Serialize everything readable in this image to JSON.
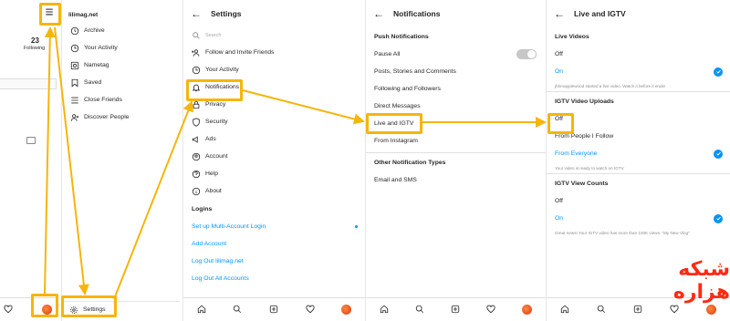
{
  "profile_panel": {
    "count": "23",
    "count_label": "Following"
  },
  "menu_panel": {
    "username": "lilimag.net",
    "items": [
      {
        "label": "Archive",
        "icon": "archive-icon"
      },
      {
        "label": "Your Activity",
        "icon": "activity-icon"
      },
      {
        "label": "Nametag",
        "icon": "nametag-icon"
      },
      {
        "label": "Saved",
        "icon": "bookmark-icon"
      },
      {
        "label": "Close Friends",
        "icon": "list-icon"
      },
      {
        "label": "Discover People",
        "icon": "add-person-icon"
      }
    ],
    "settings_label": "Settings"
  },
  "settings_panel": {
    "title": "Settings",
    "search_placeholder": "Search",
    "items": [
      {
        "label": "Follow and Invite Friends",
        "icon": "add-person-icon"
      },
      {
        "label": "Your Activity",
        "icon": "activity-icon"
      },
      {
        "label": "Notifications",
        "icon": "bell-icon"
      },
      {
        "label": "Privacy",
        "icon": "lock-icon"
      },
      {
        "label": "Security",
        "icon": "shield-icon"
      },
      {
        "label": "Ads",
        "icon": "megaphone-icon"
      },
      {
        "label": "Account",
        "icon": "account-icon"
      },
      {
        "label": "Help",
        "icon": "help-icon"
      },
      {
        "label": "About",
        "icon": "info-icon"
      }
    ],
    "logins_header": "Logins",
    "login_links": [
      "Set up Multi-Account Login",
      "Add Account",
      "Log Out lilimag.net",
      "Log Out All Accounts"
    ]
  },
  "notifications_panel": {
    "title": "Notifications",
    "push_header": "Push Notifications",
    "items": [
      "Pause All",
      "Posts, Stories and Comments",
      "Following and Followers",
      "Direct Messages",
      "Live and IGTV",
      "From Instagram"
    ],
    "other_header": "Other Notification Types",
    "other_items": [
      "Email and SMS"
    ]
  },
  "live_panel": {
    "title": "Live and IGTV",
    "live_header": "Live Videos",
    "live_off": "Off",
    "live_on": "On",
    "live_note": "jhhmapplewood started a live video. Watch it before it ends!",
    "igtv_header": "IGTV Video Uploads",
    "igtv_off": "Off",
    "igtv_people": "From People I Follow",
    "igtv_everyone": "From Everyone",
    "igtv_note": "Your video is ready to watch on IGTV.",
    "count_header": "IGTV View Counts",
    "count_off": "Off",
    "count_on": "On",
    "count_note": "Great news! Your IGTV video has more than 100K views. \"My New Vlog\""
  },
  "watermark": "شبکه هزاره",
  "colors": {
    "highlight": "#f5b50a",
    "accent": "#0095f6",
    "watermark": "#ff2a12"
  }
}
